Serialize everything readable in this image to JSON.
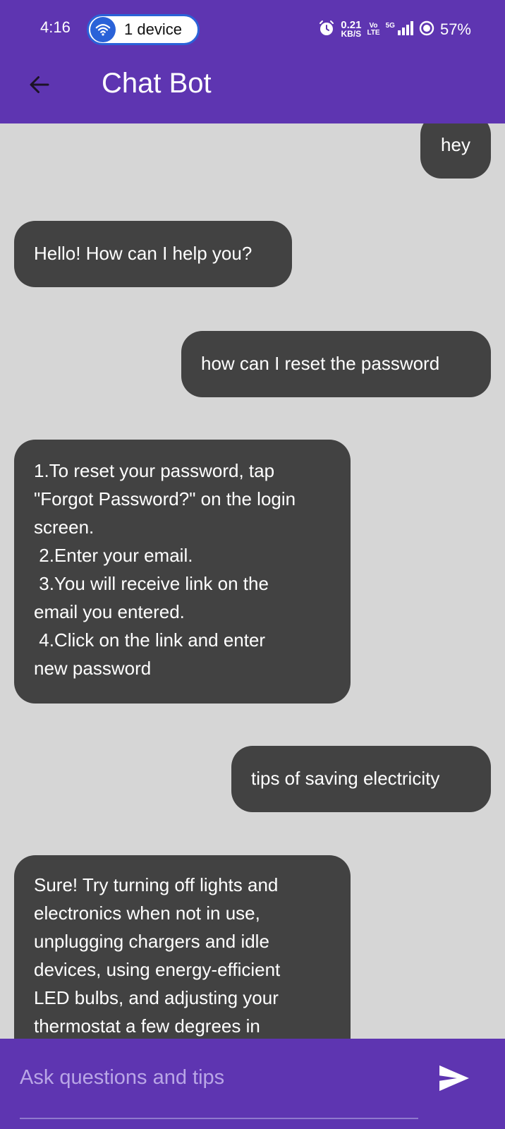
{
  "status_bar": {
    "time": "4:16",
    "device_pill": "1 device",
    "speed_value": "0.21",
    "speed_unit": "KB/S",
    "volte_top": "Vo",
    "volte_bottom": "LTE",
    "network": "5G",
    "battery": "57%"
  },
  "app_bar": {
    "title": "Chat Bot",
    "color": "#5e35b1"
  },
  "messages": [
    {
      "from": "user",
      "text": "hey"
    },
    {
      "from": "bot",
      "text": "Hello! How can I help you?"
    },
    {
      "from": "user",
      "text": "how can I reset the password"
    },
    {
      "from": "bot",
      "text": "1.To reset your password, tap\n\"Forgot Password?\" on the login\nscreen.\n 2.Enter your email.\n 3.You will receive link on the\nemail you entered.\n 4.Click on the link and enter\nnew password"
    },
    {
      "from": "user",
      "text": "tips of saving electricity"
    },
    {
      "from": "bot",
      "text": "Sure! Try turning off lights and\nelectronics when not in use,\nunplugging chargers and idle\ndevices, using energy-efficient\nLED bulbs, and adjusting your\nthermostat a few degrees in"
    }
  ],
  "input": {
    "placeholder": "Ask questions and tips",
    "value": ""
  },
  "icons": {
    "back": "arrow-left-icon",
    "send": "send-icon",
    "wifi": "wifi-icon",
    "alarm": "alarm-icon",
    "signal": "signal-icon",
    "battery": "battery-icon"
  }
}
